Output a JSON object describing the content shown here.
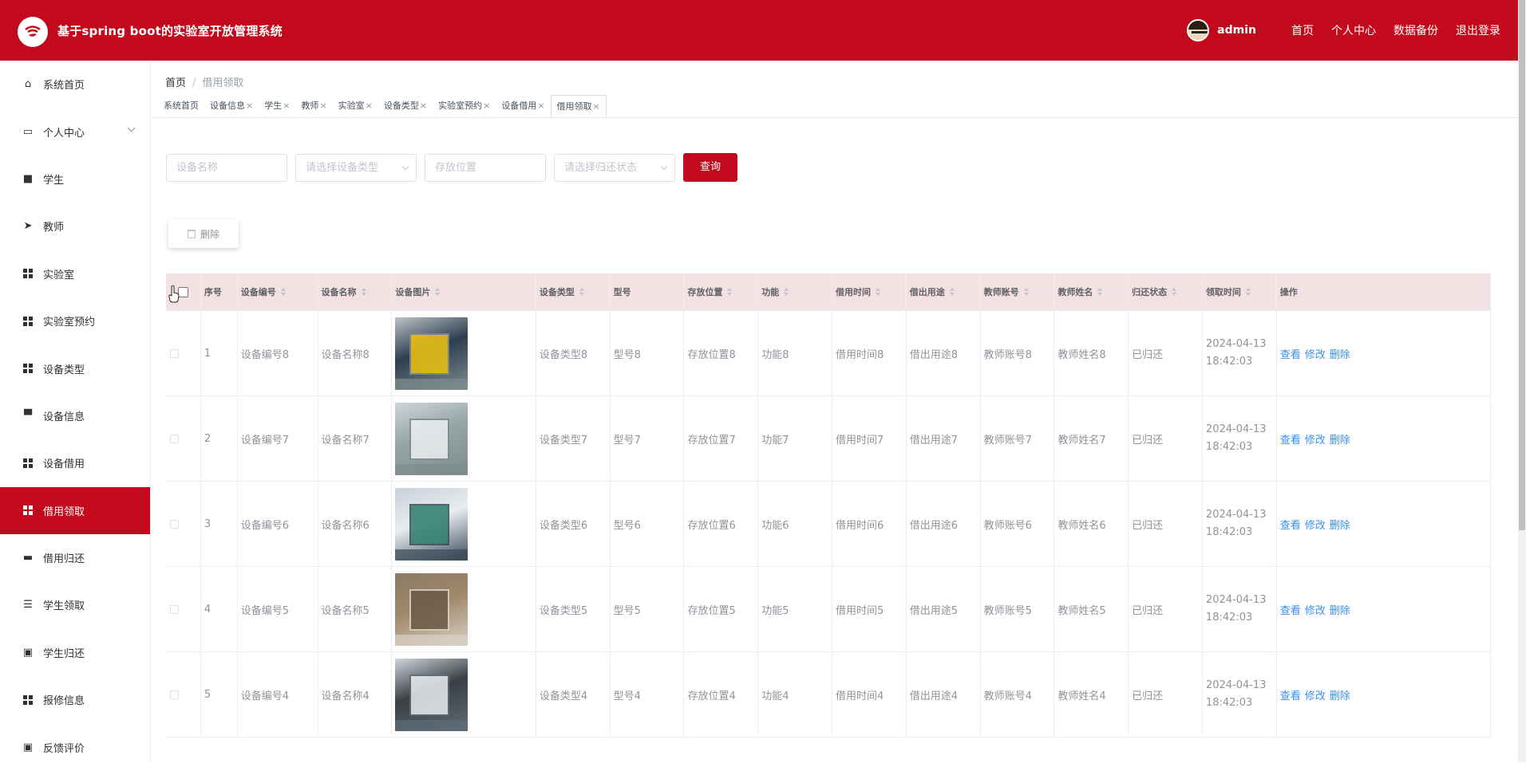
{
  "header": {
    "app_title": "基于spring boot的实验室开放管理系统",
    "username": "admin",
    "links": [
      "首页",
      "个人中心",
      "数据备份",
      "退出登录"
    ]
  },
  "sidebar": {
    "items": [
      {
        "label": "系统首页",
        "icon": "home-icon"
      },
      {
        "label": "个人中心",
        "icon": "card-icon"
      },
      {
        "label": "学生",
        "icon": "briefcase-icon"
      },
      {
        "label": "教师",
        "icon": "paper-plane-icon"
      },
      {
        "label": "实验室",
        "icon": "grid-icon"
      },
      {
        "label": "实验室预约",
        "icon": "grid-icon"
      },
      {
        "label": "设备类型",
        "icon": "grid-icon"
      },
      {
        "label": "设备信息",
        "icon": "monitor-icon"
      },
      {
        "label": "设备借用",
        "icon": "grid-icon"
      },
      {
        "label": "借用领取",
        "icon": "grid-icon"
      },
      {
        "label": "借用归还",
        "icon": "printer-icon"
      },
      {
        "label": "学生领取",
        "icon": "list-icon"
      },
      {
        "label": "学生归还",
        "icon": "clipboard-x-icon"
      },
      {
        "label": "报修信息",
        "icon": "grid-icon"
      },
      {
        "label": "反馈评价",
        "icon": "clipboard-check-icon"
      }
    ]
  },
  "breadcrumb": {
    "home": "首页",
    "sep": "/",
    "current": "借用领取"
  },
  "tabs": [
    {
      "label": "系统首页",
      "closable": false
    },
    {
      "label": "设备信息",
      "closable": true
    },
    {
      "label": "学生",
      "closable": true
    },
    {
      "label": "教师",
      "closable": true
    },
    {
      "label": "实验室",
      "closable": true
    },
    {
      "label": "设备类型",
      "closable": true
    },
    {
      "label": "实验室预约",
      "closable": true
    },
    {
      "label": "设备借用",
      "closable": true
    },
    {
      "label": "借用领取",
      "closable": true
    }
  ],
  "tab_close_glyph": "×",
  "search": {
    "device_name_placeholder": "设备名称",
    "device_type_placeholder": "请选择设备类型",
    "location_placeholder": "存放位置",
    "return_status_placeholder": "请选择归还状态",
    "query_label": "查询"
  },
  "toolbar": {
    "delete_label": "删除"
  },
  "table": {
    "columns": [
      "序号",
      "设备编号",
      "设备名称",
      "设备图片",
      "设备类型",
      "型号",
      "存放位置",
      "功能",
      "借用时间",
      "借出用途",
      "教师账号",
      "教师姓名",
      "归还状态",
      "领取时间",
      "操作"
    ],
    "rows": [
      {
        "idx": "1",
        "code": "设备编号8",
        "name": "设备名称8",
        "type": "设备类型8",
        "model": "型号8",
        "loc": "存放位置8",
        "func": "功能8",
        "borrow_time": "借用时间8",
        "purpose": "借出用途8",
        "teacher_acc": "教师账号8",
        "teacher_name": "教师姓名8",
        "status": "已归还",
        "receive_time": "2024-04-13 18:42:03"
      },
      {
        "idx": "2",
        "code": "设备编号7",
        "name": "设备名称7",
        "type": "设备类型7",
        "model": "型号7",
        "loc": "存放位置7",
        "func": "功能7",
        "borrow_time": "借用时间7",
        "purpose": "借出用途7",
        "teacher_acc": "教师账号7",
        "teacher_name": "教师姓名7",
        "status": "已归还",
        "receive_time": "2024-04-13 18:42:03"
      },
      {
        "idx": "3",
        "code": "设备编号6",
        "name": "设备名称6",
        "type": "设备类型6",
        "model": "型号6",
        "loc": "存放位置6",
        "func": "功能6",
        "borrow_time": "借用时间6",
        "purpose": "借出用途6",
        "teacher_acc": "教师账号6",
        "teacher_name": "教师姓名6",
        "status": "已归还",
        "receive_time": "2024-04-13 18:42:03"
      },
      {
        "idx": "4",
        "code": "设备编号5",
        "name": "设备名称5",
        "type": "设备类型5",
        "model": "型号5",
        "loc": "存放位置5",
        "func": "功能5",
        "borrow_time": "借用时间5",
        "purpose": "借出用途5",
        "teacher_acc": "教师账号5",
        "teacher_name": "教师姓名5",
        "status": "已归还",
        "receive_time": "2024-04-13 18:42:03"
      },
      {
        "idx": "5",
        "code": "设备编号4",
        "name": "设备名称4",
        "type": "设备类型4",
        "model": "型号4",
        "loc": "存放位置4",
        "func": "功能4",
        "borrow_time": "借用时间4",
        "purpose": "借出用途4",
        "teacher_acc": "教师账号4",
        "teacher_name": "教师姓名4",
        "status": "已归还",
        "receive_time": "2024-04-13 18:42:03"
      }
    ],
    "actions": [
      "查看",
      "修改",
      "删除"
    ]
  },
  "colors": {
    "brand": "#c20a1c",
    "table_header_bg": "#f3e1e3",
    "link": "#3a8ee6"
  }
}
